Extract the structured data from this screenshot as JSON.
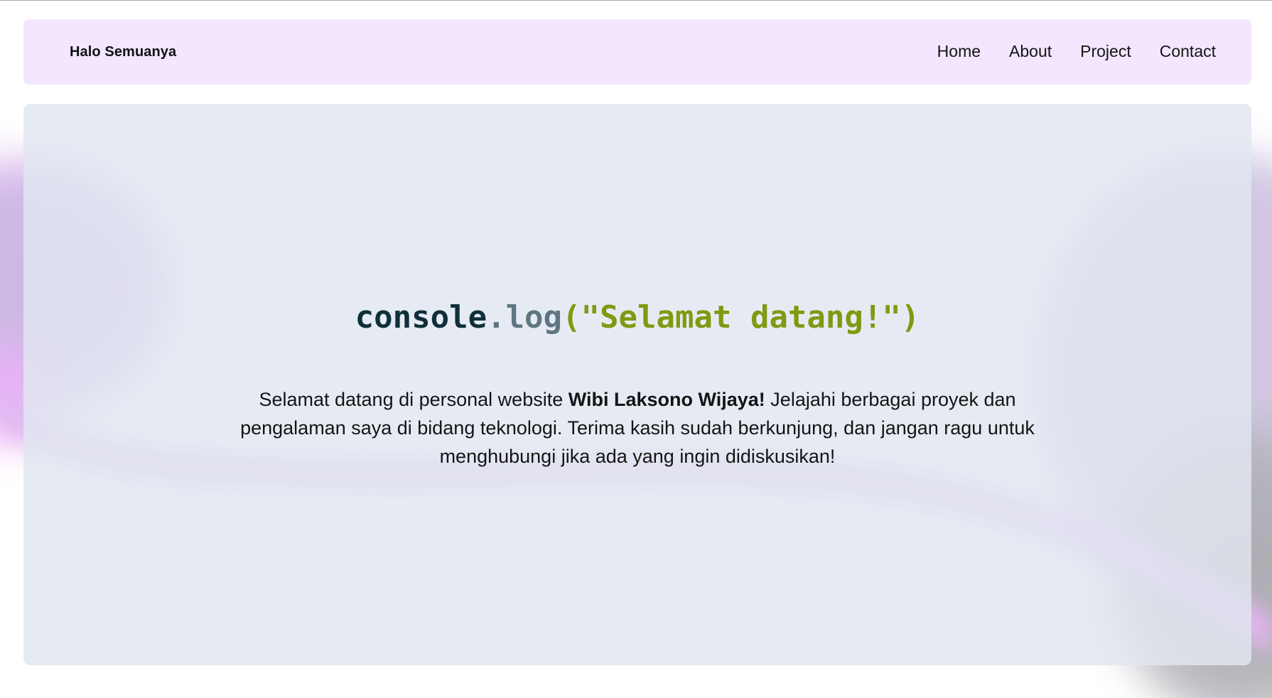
{
  "navbar": {
    "brand": "Halo Semuanya",
    "links": [
      "Home",
      "About",
      "Project",
      "Contact"
    ]
  },
  "hero": {
    "code": {
      "object": "console",
      "dot": ".",
      "method": "log",
      "args": "(\"Selamat datang!\")"
    },
    "intro_before": "Selamat datang di personal website ",
    "intro_name": "Wibi Laksono Wijaya!",
    "intro_after": " Jelajahi berbagai proyek dan pengalaman saya di bidang teknologi. Terima kasih sudah berkunjung, dan jangan ragu untuk menghubungi jika ada yang ingin didiskusikan!"
  },
  "colors": {
    "navbar_bg": "#f3e6fe",
    "hero_bg": "#e1e6f0",
    "code_object": "#0f2f3a",
    "code_method": "#5e7682",
    "code_string": "#7f9a12"
  }
}
